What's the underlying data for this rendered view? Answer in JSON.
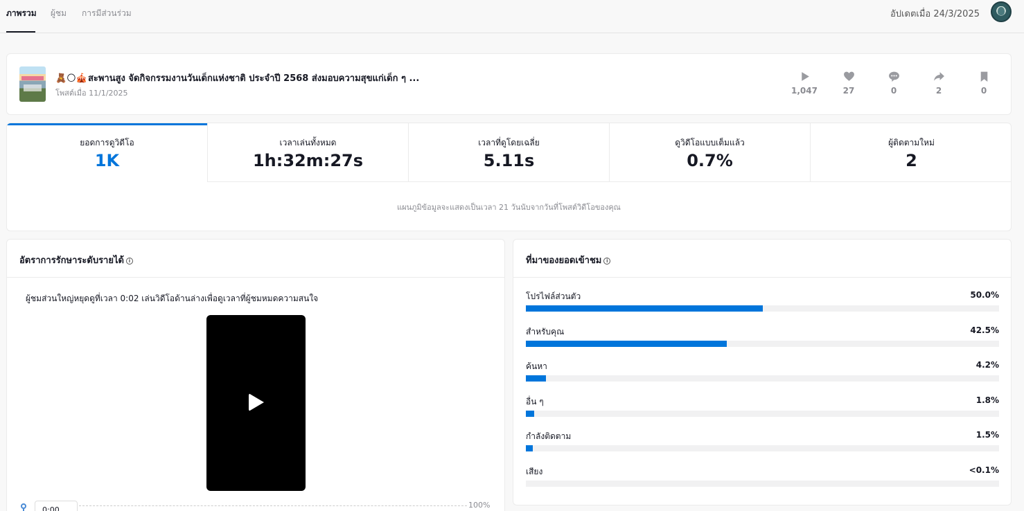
{
  "tabs": {
    "overview": "ภาพรวม",
    "viewers": "ผู้ชม",
    "engagement": "การมีส่วนร่วม"
  },
  "updated": "อัปเดตเมื่อ 24/3/2025",
  "post": {
    "emojis": "🧸🌕🎪",
    "title": "สะพานสูง จัดกิจกรรมงานวันเด็กแห่งชาติ ประจำปี 2568 ส่งมอบความสุขแก่เด็ก ๆ ...",
    "date": "โพสต์เมื่อ 11/1/2025",
    "stats": {
      "views": "1,047",
      "likes": "27",
      "comments": "0",
      "shares": "2",
      "saves": "0"
    }
  },
  "metrics": {
    "views_label": "ยอดการดูวิดีโอ",
    "views_value": "1K",
    "total_time_label": "เวลาเล่นทั้งหมด",
    "total_time_value": "1h:32m:27s",
    "avg_time_label": "เวลาที่ดูโดยเฉลี่ย",
    "avg_time_value": "5.11s",
    "full_watch_label": "ดูวิดีโอแบบเต็มแล้ว",
    "full_watch_value": "0.7%",
    "new_followers_label": "ผู้ติดตามใหม่",
    "new_followers_value": "2",
    "note": "แผนภูมิข้อมูลจะแสดงเป็นเวลา 21 วันนับจากวันที่โพสต์วิดีโอของคุณ"
  },
  "retention": {
    "title": "อัตราการรักษาระดับรายได้",
    "info": "i",
    "description": "ผู้ชมส่วนใหญ่หยุดดูที่เวลา 0:02 เล่นวิดีโอด้านล่างเพื่อดูเวลาที่ผู้ชมหมดความสนใจ",
    "time": "0:00",
    "max_label": "100%"
  },
  "sources": {
    "title": "ที่มาของยอดเข้าชม",
    "info": "i",
    "accent_color": "#0075db",
    "items": [
      {
        "label": "โปรไฟล์ส่วนตัว",
        "value": "50.0%",
        "fraction": 0.5
      },
      {
        "label": "สำหรับคุณ",
        "value": "42.5%",
        "fraction": 0.425
      },
      {
        "label": "ค้นหา",
        "value": "4.2%",
        "fraction": 0.042
      },
      {
        "label": "อื่น ๆ",
        "value": "1.8%",
        "fraction": 0.018
      },
      {
        "label": "กำลังติดตาม",
        "value": "1.5%",
        "fraction": 0.015
      },
      {
        "label": "เสียง",
        "value": "<0.1%",
        "fraction": 0.0
      }
    ]
  }
}
